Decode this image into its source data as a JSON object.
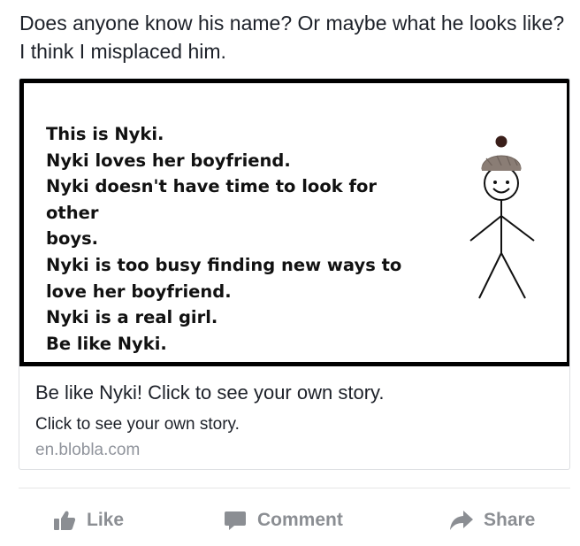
{
  "post": {
    "text": "Does anyone know his name? Or maybe what he looks like? I think I misplaced him."
  },
  "link_card": {
    "image": {
      "lines": [
        "This is Nyki.",
        "Nyki loves her boyfriend.",
        "Nyki doesn't have time to look for other",
        "boys.",
        "Nyki is too busy finding new ways to",
        "love her boyfriend.",
        "Nyki is a real girl.",
        "Be like Nyki."
      ],
      "figure_icon": "stick-figure-with-beanie",
      "frame_color": "#000000",
      "hat_color": "#8a7d75"
    },
    "title": "Be like Nyki! Click to see your own story.",
    "description": "Click to see your own story.",
    "domain": "en.blobla.com"
  },
  "actions": {
    "like": {
      "label": "Like",
      "icon": "thumbs-up-icon"
    },
    "comment": {
      "label": "Comment",
      "icon": "comment-icon"
    },
    "share": {
      "label": "Share",
      "icon": "share-arrow-icon"
    }
  },
  "colors": {
    "text": "#1d2129",
    "secondary_text": "#90949c",
    "action_gray": "#8b8e93",
    "divider": "#e5e5e5"
  }
}
